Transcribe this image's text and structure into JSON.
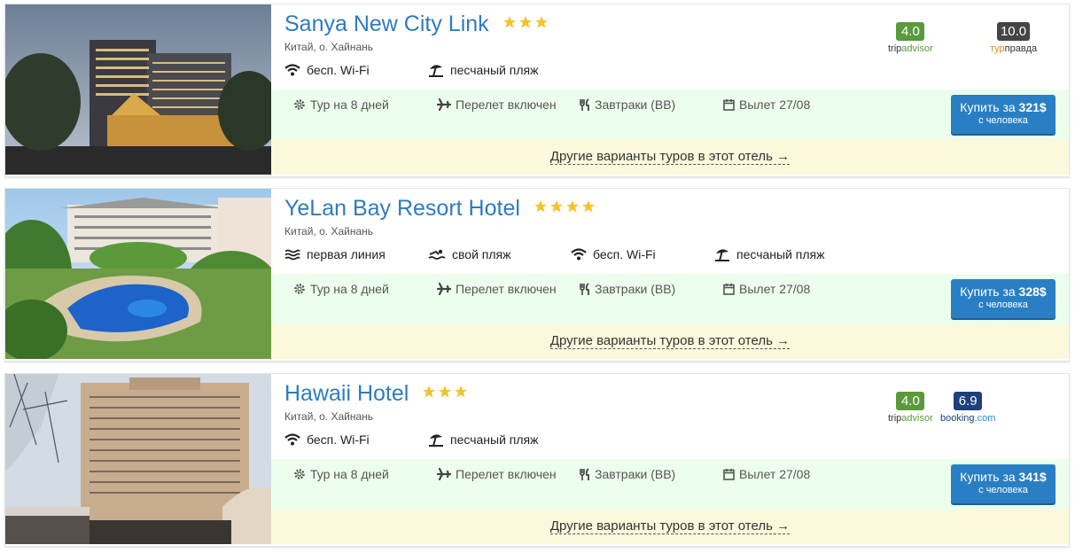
{
  "hotels": [
    {
      "name": "Sanya New City Link",
      "stars": 3,
      "location": "Китай, о. Хайнань",
      "amenities": [
        {
          "icon": "wifi-icon",
          "label": "бесп. Wi-Fi"
        },
        {
          "icon": "beach-umbrella-icon",
          "label": "песчаный пляж"
        }
      ],
      "tour": {
        "duration": "Тур на 8 дней",
        "flight": "Перелет включен",
        "meals": "Завтраки (BB)",
        "departure": "Вылет 27/08"
      },
      "buy": {
        "prefix": "Купить за",
        "price": "321$",
        "sub": "с человека"
      },
      "ratings": [
        {
          "score": "4.0",
          "brand_a": "trip",
          "brand_b": "advisor",
          "color": "#5a9a3a"
        },
        {
          "score": "10.0",
          "brand_a": "тур",
          "brand_b": "правда",
          "color": "#444444"
        }
      ],
      "other_link": "Другие варианты туров в этот отель →"
    },
    {
      "name": "YeLan Bay Resort Hotel",
      "stars": 4,
      "location": "Китай, о. Хайнань",
      "amenities": [
        {
          "icon": "waves-icon",
          "label": "первая линия"
        },
        {
          "icon": "swimmer-icon",
          "label": "свой пляж"
        },
        {
          "icon": "wifi-icon",
          "label": "бесп. Wi-Fi"
        },
        {
          "icon": "beach-umbrella-icon",
          "label": "песчаный пляж"
        }
      ],
      "tour": {
        "duration": "Тур на 8 дней",
        "flight": "Перелет включен",
        "meals": "Завтраки (BB)",
        "departure": "Вылет 27/08"
      },
      "buy": {
        "prefix": "Купить за",
        "price": "328$",
        "sub": "с человека"
      },
      "ratings": [],
      "other_link": "Другие варианты туров в этот отель →"
    },
    {
      "name": "Hawaii Hotel",
      "stars": 3,
      "location": "Китай, о. Хайнань",
      "amenities": [
        {
          "icon": "wifi-icon",
          "label": "бесп. Wi-Fi"
        },
        {
          "icon": "beach-umbrella-icon",
          "label": "песчаный пляж"
        }
      ],
      "tour": {
        "duration": "Тур на 8 дней",
        "flight": "Перелет включен",
        "meals": "Завтраки (BB)",
        "departure": "Вылет 27/08"
      },
      "buy": {
        "prefix": "Купить за",
        "price": "341$",
        "sub": "с человека"
      },
      "ratings": [
        {
          "score": "4.0",
          "brand_a": "trip",
          "brand_b": "advisor",
          "color": "#5a9a3a"
        },
        {
          "score": "6.9",
          "brand_a": "booking",
          "brand_b": ".com",
          "color": "#1f3f7a"
        }
      ],
      "other_link": "Другие варианты туров в этот отель →"
    }
  ],
  "colors": {
    "accent": "#2f7bbf",
    "star": "#f2c230",
    "tour_bar": "#ecffec",
    "link_bar": "#fcf8dc",
    "button": "#2a7fc4"
  }
}
